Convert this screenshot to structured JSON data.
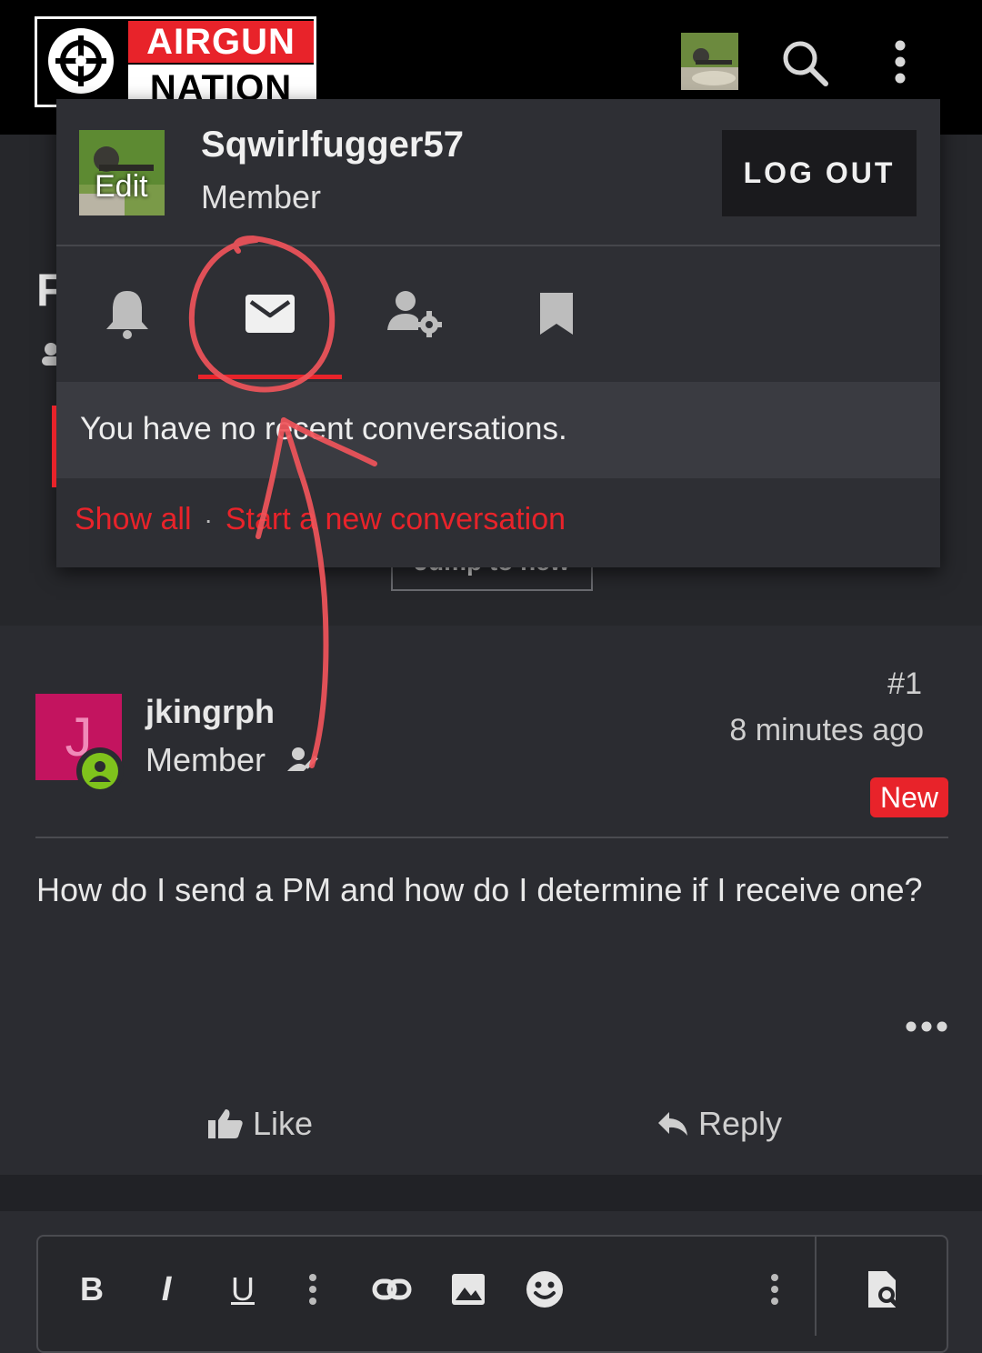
{
  "header": {
    "logo_top": "AIRGUN",
    "logo_bottom": "NATION"
  },
  "page": {
    "title_peek": "F",
    "jump_label": "Jump to new"
  },
  "account_menu": {
    "username": "Sqwirlfugger57",
    "role": "Member",
    "avatar_edit": "Edit",
    "logout": "LOG OUT",
    "tabs": [
      "alerts",
      "conversations",
      "account-settings",
      "bookmarks"
    ],
    "active_tab": "conversations",
    "message": "You have no recent conversations.",
    "show_all": "Show all",
    "separator": "·",
    "start_new": "Start a new conversation"
  },
  "post": {
    "avatar_letter": "J",
    "author": "jkingrph",
    "role": "Member",
    "number": "#1",
    "time": "8 minutes ago",
    "badge": "New",
    "body": "How do I send a PM and how do I determine if I receive one?",
    "like_label": "Like",
    "reply_label": "Reply"
  },
  "editor": {
    "toolbar": [
      "bold",
      "italic",
      "underline",
      "more-options",
      "link",
      "image",
      "emoji",
      "more-options",
      "preview"
    ],
    "bold": "B",
    "italic": "I",
    "underline": "U"
  },
  "colors": {
    "accent": "#e8232a",
    "background": "#2b2c31",
    "header": "#000000",
    "avatar_magenta": "#c3145f",
    "online_green": "#7fc31c"
  }
}
